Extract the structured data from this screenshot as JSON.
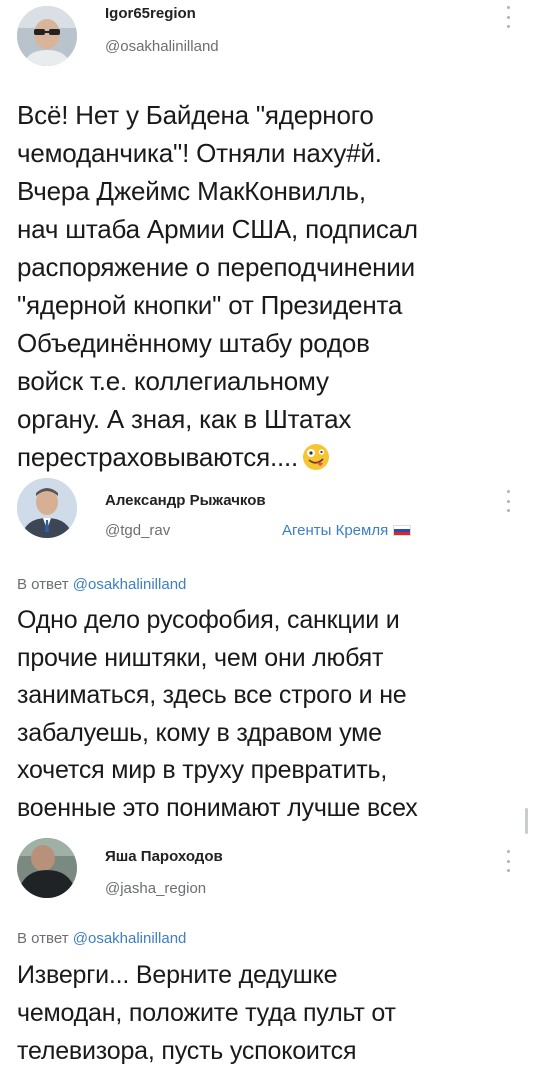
{
  "posts": [
    {
      "author": "Igor65region",
      "handle": "@osakhalinilland",
      "lines": [
        "Всё! Нет у Байдена \"ядерного",
        "чемоданчика\"! Отняли наху#й.",
        "Вчера Джеймс МакКонвилль,",
        "нач штаба Армии США, подписал",
        "распоряжение о переподчинении",
        "\"ядерной кнопки\" от Президента",
        "Объединённому штабу родов",
        "войск т.е. коллегиальному",
        "органу. А зная, как в Штатах",
        "перестраховываются...."
      ],
      "emoji": "zany-face-emoji"
    },
    {
      "author": "Александр Рыжачков",
      "handle": "@tgd_rav",
      "badge": "Агенты Кремля",
      "reply_label": "В ответ",
      "reply_mention": "@osakhalinilland",
      "lines": [
        "Одно дело русофобия, санкции и",
        "прочие ништяки, чем они любят",
        "заниматься, здесь все строго и не",
        "забалуешь, кому в здравом уме",
        "хочется мир в труху превратить,",
        "военные это понимают лучше всех"
      ]
    },
    {
      "author": "Яша Пароходов",
      "handle": "@jasha_region",
      "reply_label": "В ответ",
      "reply_mention": "@osakhalinilland",
      "lines": [
        "Изверги... Верните дедушке",
        "чемодан, положите туда пульт от",
        "телевизора, пусть успокоится"
      ]
    }
  ],
  "colors": {
    "link": "#3d7fc4",
    "muted": "#6b6f74",
    "text": "#1a1a1a"
  }
}
